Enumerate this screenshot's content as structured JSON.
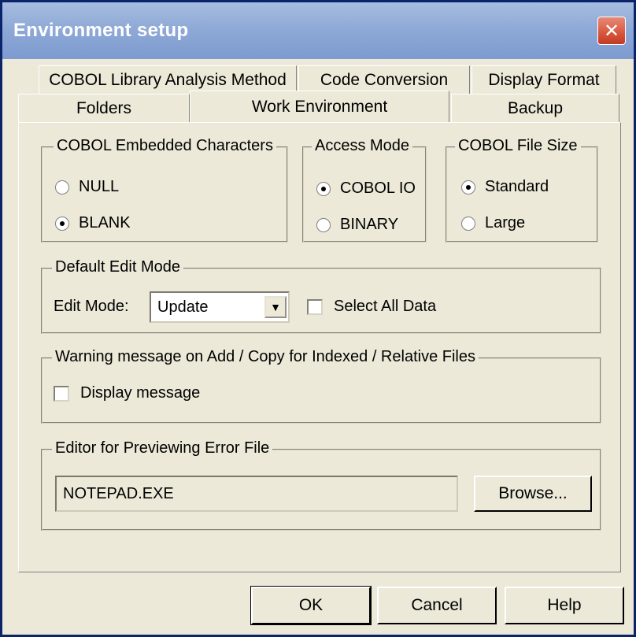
{
  "window": {
    "title": "Environment setup",
    "close_glyph": "✕"
  },
  "tabs": {
    "row1": [
      "COBOL Library Analysis Method",
      "Code Conversion",
      "Display Format"
    ],
    "row2": [
      "Folders",
      "Work Environment",
      "Backup"
    ],
    "active": "Work Environment"
  },
  "embedded_chars": {
    "label": "COBOL Embedded Characters",
    "options": [
      "NULL",
      "BLANK"
    ],
    "selected": "BLANK"
  },
  "access_mode": {
    "label": "Access Mode",
    "options": [
      "COBOL IO",
      "BINARY"
    ],
    "selected": "COBOL IO"
  },
  "file_size": {
    "label": "COBOL File Size",
    "options": [
      "Standard",
      "Large"
    ],
    "selected": "Standard"
  },
  "edit_mode": {
    "group_label": "Default Edit Mode",
    "field_label": "Edit Mode:",
    "value": "Update",
    "select_all_label": "Select All Data",
    "select_all_checked": false
  },
  "warning": {
    "group_label": "Warning message on Add / Copy for Indexed / Relative Files",
    "display_label": "Display message",
    "display_checked": false
  },
  "editor": {
    "group_label": "Editor for Previewing Error File",
    "value": "NOTEPAD.EXE",
    "browse_label": "Browse..."
  },
  "buttons": {
    "ok": "OK",
    "cancel": "Cancel",
    "help": "Help"
  },
  "icons": {
    "dropdown": "▼"
  }
}
